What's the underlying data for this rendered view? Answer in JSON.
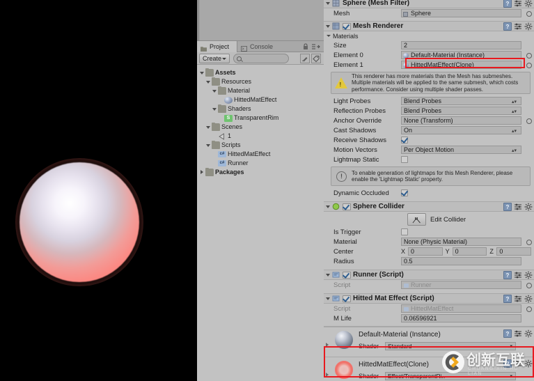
{
  "scene": {
    "name": "scene-view",
    "background": "#000000",
    "object_label": "sphere-with-rim-effect",
    "rim_color": "#fb8a84",
    "core_color": "#ffffff"
  },
  "project_panel": {
    "tabs": [
      {
        "label": "Project",
        "icon": "folder-icon",
        "active": true
      },
      {
        "label": "Console",
        "icon": "console-icon",
        "active": false
      }
    ],
    "lock_icon": "lock-icon",
    "menu_icon": "panel-menu-icon",
    "toolbar": {
      "create_label": "Create",
      "search_value": "",
      "search_placeholder": "",
      "filter_icon": "filter-type-icon",
      "label_icon": "filter-label-icon"
    },
    "tree": [
      {
        "label": "Assets",
        "depth": 0,
        "icon": "folder-icon",
        "expanded": true,
        "bold": true
      },
      {
        "label": "Resources",
        "depth": 1,
        "icon": "folder-icon",
        "expanded": true,
        "bold": false
      },
      {
        "label": "Material",
        "depth": 2,
        "icon": "folder-icon",
        "expanded": true,
        "bold": false
      },
      {
        "label": "HittedMatEffect",
        "depth": 3,
        "icon": "material-icon",
        "expanded": null,
        "bold": false
      },
      {
        "label": "Shaders",
        "depth": 2,
        "icon": "folder-icon",
        "expanded": true,
        "bold": false
      },
      {
        "label": "TransparentRim",
        "depth": 3,
        "icon": "shader-icon",
        "expanded": null,
        "bold": false
      },
      {
        "label": "Scenes",
        "depth": 1,
        "icon": "folder-icon",
        "expanded": true,
        "bold": false
      },
      {
        "label": "1",
        "depth": 2,
        "icon": "scene-icon",
        "expanded": null,
        "bold": false
      },
      {
        "label": "Scripts",
        "depth": 1,
        "icon": "folder-icon",
        "expanded": true,
        "bold": false
      },
      {
        "label": "HittedMatEffect",
        "depth": 2,
        "icon": "script-icon",
        "expanded": null,
        "bold": false
      },
      {
        "label": "Runner",
        "depth": 2,
        "icon": "script-icon",
        "expanded": null,
        "bold": false
      },
      {
        "label": "Packages",
        "depth": 0,
        "icon": "folder-icon",
        "expanded": false,
        "bold": true
      }
    ]
  },
  "inspector": {
    "mesh_filter": {
      "title": "Sphere (Mesh Filter)",
      "mesh_label": "Mesh",
      "mesh_value": "Sphere"
    },
    "mesh_renderer": {
      "title": "Mesh Renderer",
      "enabled": true,
      "materials_label": "Materials",
      "size_label": "Size",
      "size_value": "2",
      "elements": [
        {
          "label": "Element 0",
          "value": "Default-Material (Instance)",
          "highlighted": false
        },
        {
          "label": "Element 1",
          "value": "HittedMatEffect(Clone)",
          "highlighted": true
        }
      ],
      "warning": "This renderer has more materials than the Mesh has submeshes. Multiple materials will be applied to the same submesh, which costs performance. Consider using multiple shader passes.",
      "properties": [
        {
          "label": "Light Probes",
          "type": "dropdown",
          "value": "Blend Probes"
        },
        {
          "label": "Reflection Probes",
          "type": "dropdown",
          "value": "Blend Probes"
        },
        {
          "label": "Anchor Override",
          "type": "object",
          "value": "None (Transform)"
        },
        {
          "label": "Cast Shadows",
          "type": "dropdown",
          "value": "On"
        },
        {
          "label": "Receive Shadows",
          "type": "checkbox",
          "value": true
        },
        {
          "label": "Motion Vectors",
          "type": "dropdown",
          "value": "Per Object Motion"
        },
        {
          "label": "Lightmap Static",
          "type": "checkbox",
          "value": false
        }
      ],
      "info": "To enable generation of lightmaps for this Mesh Renderer, please enable the 'Lightmap Static' property.",
      "dynamic_occluded_label": "Dynamic Occluded",
      "dynamic_occluded_value": true
    },
    "sphere_collider": {
      "title": "Sphere Collider",
      "enabled": true,
      "edit_collider_label": "Edit Collider",
      "rows": [
        {
          "label": "Is Trigger",
          "type": "checkbox",
          "value": false
        },
        {
          "label": "Material",
          "type": "object",
          "value": "None (Physic Material)"
        }
      ],
      "center_label": "Center",
      "center": {
        "x": "0",
        "y": "0",
        "z": "0"
      },
      "radius_label": "Radius",
      "radius_value": "0.5"
    },
    "runner_script": {
      "title": "Runner (Script)",
      "enabled": true,
      "script_label": "Script",
      "script_value": "Runner"
    },
    "hitted_mat_effect_script": {
      "title": "Hitted Mat Effect (Script)",
      "enabled": true,
      "script_label": "Script",
      "script_value": "HittedMatEffect",
      "m_life_label": "M Life",
      "m_life_value": "0.06596921"
    },
    "materials": [
      {
        "title": "Default-Material (Instance)",
        "shader_label": "Shader",
        "shader_value": "Standard",
        "highlighted": false
      },
      {
        "title": "HittedMatEffect(Clone)",
        "shader_label": "Shader",
        "shader_value": "Effect/TransparentRi..",
        "highlighted": true
      }
    ],
    "header_icons": {
      "help": "help-icon",
      "preset": "preset-icon",
      "gear": "gear-icon"
    }
  },
  "watermark": {
    "title": "创新互联",
    "subtitle": "CHUANG XIN HU LIAN",
    "logo": "cx-logo-icon",
    "accent": "#f0a91e"
  },
  "colors": {
    "highlight_red": "#e8191f",
    "panel_bg": "#c2c2c2",
    "field_bg": "#b4b4b4"
  }
}
